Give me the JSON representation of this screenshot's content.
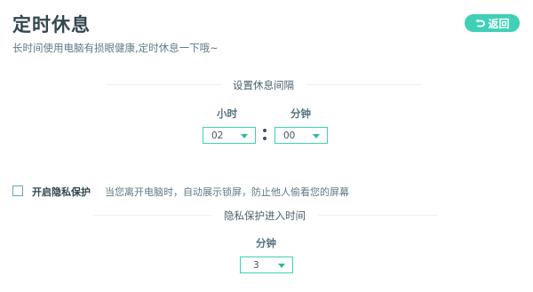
{
  "header": {
    "title": "定时休息",
    "subtitle": "长时间使用电脑有损眼健康,定时休息一下哦~",
    "back_label": "返回"
  },
  "interval": {
    "section_title": "设置休息间隔",
    "hour_label": "小时",
    "minute_label": "分钟",
    "hour_value": "02",
    "minute_value": "00"
  },
  "privacy": {
    "checkbox_label": "开启隐私保护",
    "checked": false,
    "description": "当您离开电脑时，自动展示锁屏，防止他人偷看您的屏幕",
    "section_title": "隐私保护进入时间",
    "minute_label": "分钟",
    "minute_value": "3"
  },
  "colors": {
    "accent": "#3fd0b6",
    "title": "#33474f",
    "text": "#5d7a86"
  }
}
